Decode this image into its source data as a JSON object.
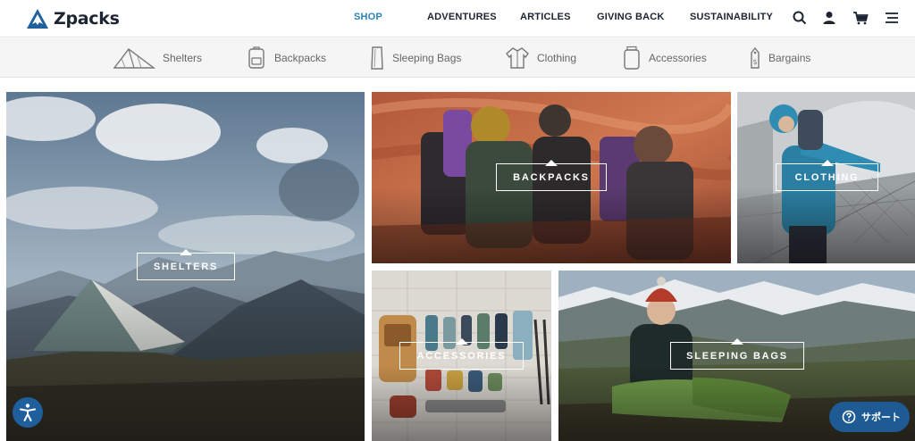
{
  "brand": {
    "name": "Zpacks"
  },
  "nav": {
    "items": [
      {
        "label": "SHOP",
        "active": true
      },
      {
        "label": "ADVENTURES"
      },
      {
        "label": "ARTICLES"
      },
      {
        "label": "GIVING BACK"
      },
      {
        "label": "SUSTAINABILITY"
      }
    ],
    "icons": [
      "search-icon",
      "account-icon",
      "cart-icon",
      "menu-icon"
    ]
  },
  "categories": [
    {
      "label": "Shelters",
      "icon": "tent-icon"
    },
    {
      "label": "Backpacks",
      "icon": "backpack-icon"
    },
    {
      "label": "Sleeping Bags",
      "icon": "sleeping-bag-icon"
    },
    {
      "label": "Clothing",
      "icon": "jacket-icon"
    },
    {
      "label": "Accessories",
      "icon": "bottle-icon"
    },
    {
      "label": "Bargains",
      "icon": "price-tag-icon"
    }
  ],
  "tiles": {
    "shelters": "SHELTERS",
    "backpacks": "BACKPACKS",
    "clothing": "CLOTHING",
    "accessories": "ACCESSORIES",
    "sleeping_bags": "SLEEPING BAGS"
  },
  "widgets": {
    "support_label": "サポート",
    "accessibility_icon": "accessibility-icon"
  },
  "colors": {
    "accent": "#2a83b9",
    "support": "#1e5b94"
  }
}
